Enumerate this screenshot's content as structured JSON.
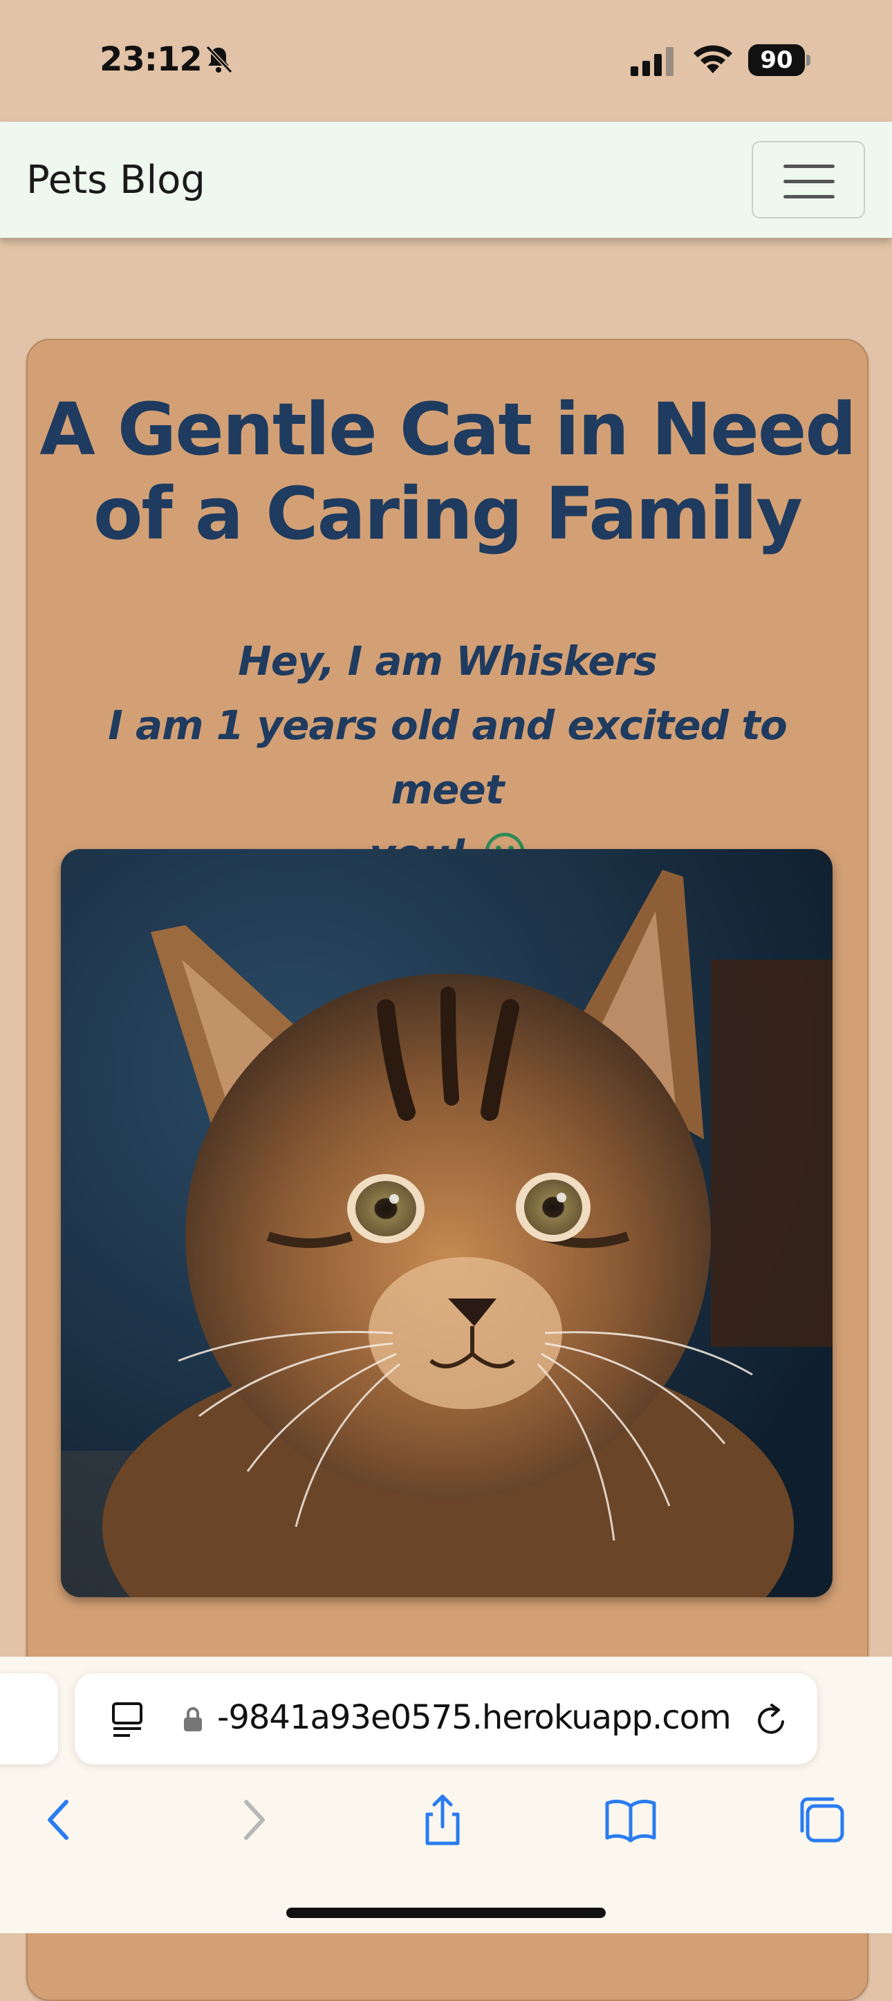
{
  "status_bar": {
    "time": "23:12",
    "battery": "90"
  },
  "navbar": {
    "brand": "Pets Blog"
  },
  "card": {
    "title_line1": "A Gentle Cat in Need",
    "title_line2": "of a Caring Family",
    "intro_line1": "Hey, I am Whiskers",
    "intro_line2": "I am 1 years old and excited to meet",
    "intro_line3": "you!"
  },
  "browser": {
    "url": "-9841a93e0575.herokuapp.com"
  },
  "colors": {
    "background": "#e2c3a7",
    "card": "#d3a075",
    "navbar": "#eef8ef",
    "heading": "#1f3b5f",
    "smile": "#2e8b57",
    "safari_blue": "#2a7cf0"
  }
}
